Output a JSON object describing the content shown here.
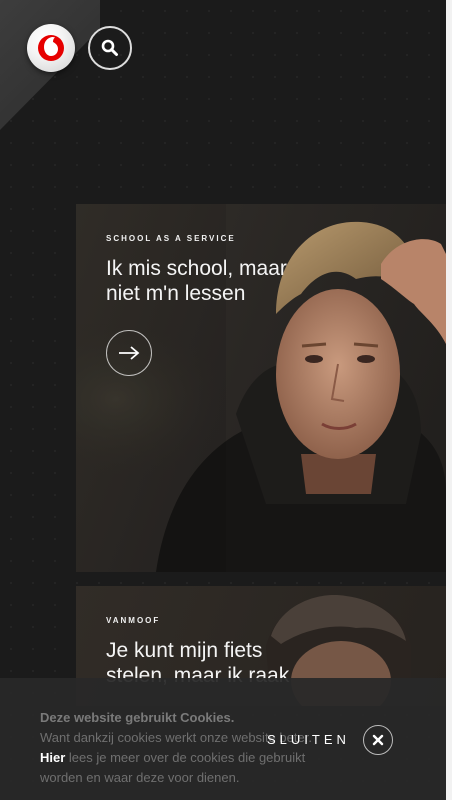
{
  "header": {
    "logo_icon": "vodafone-logo",
    "search_icon": "search-icon",
    "brand_color": "#e60000"
  },
  "cards": [
    {
      "label": "SCHOOL AS A SERVICE",
      "title_line1": "Ik mis school, maar",
      "title_line2": "niet m'n lessen",
      "action_icon": "arrow-right-icon"
    },
    {
      "label": "VANMOOF",
      "title_line1": "Je kunt mijn fiets",
      "title_line2": "stelen, maar ik raak"
    }
  ],
  "cookie_banner": {
    "title": "Deze website gebruikt Cookies.",
    "text_before_link": "Want dankzij cookies werkt onze website beter. ",
    "link_label": "Hier",
    "text_after_link": " lees je meer over de cookies die gebruikt worden en waar deze voor dienen.",
    "dismiss_label": "SLUITEN",
    "close_icon": "close-icon"
  }
}
